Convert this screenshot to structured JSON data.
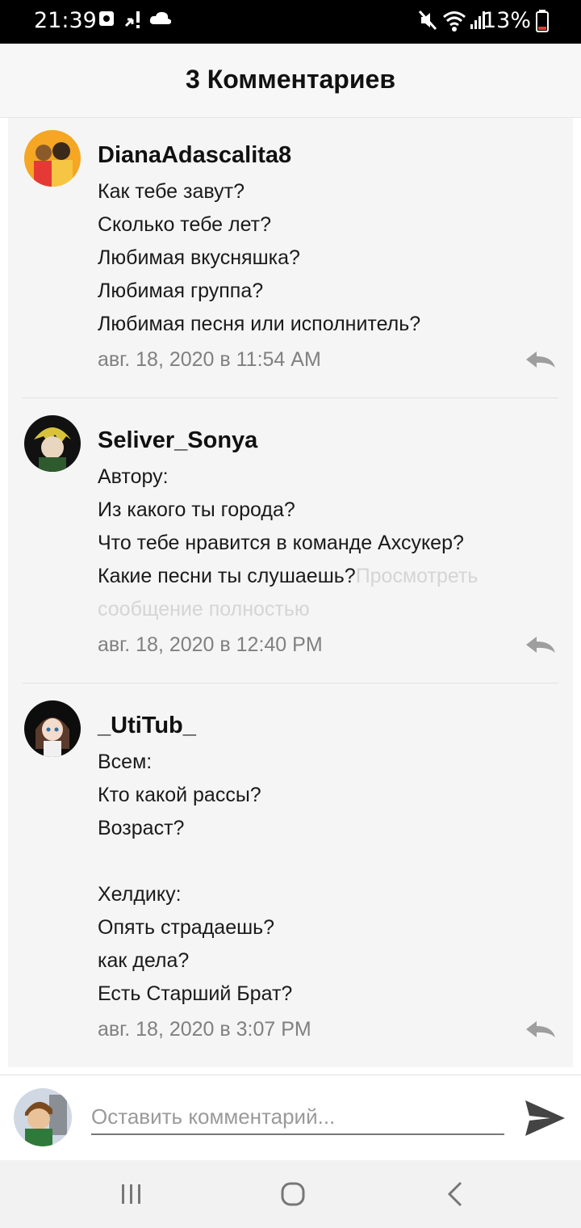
{
  "status_bar": {
    "time": "21:39",
    "battery": "13%",
    "left_icons": [
      "photo-notification-icon",
      "missed-call-icon",
      "cloud-icon"
    ],
    "right_icons": [
      "mute-icon",
      "wifi-icon",
      "signal-icon",
      "battery-icon"
    ]
  },
  "header": {
    "title": "3 Комментариев"
  },
  "comments": [
    {
      "username": "DianaAdascalita8",
      "lines": [
        "Как тебе завут?",
        "Сколько тебе лет?",
        "Любимая вкусняшка?",
        "Любимая группа?",
        "Любимая песня или исполнитель?"
      ],
      "timestamp": "авг. 18, 2020 в 11:54 AM"
    },
    {
      "username": "Seliver_Sonya",
      "lines": [
        "Автору:",
        "Из какого ты города?",
        "Что тебе нравится в команде Ахсукер?",
        "Какие песни ты слушаешь?"
      ],
      "more_inline": "Просмотреть",
      "more_line2": "сообщение полностью",
      "timestamp": "авг. 18, 2020 в 12:40 PM"
    },
    {
      "username": "_UtiTub_",
      "lines": [
        "Всем:",
        "Кто какой рассы?",
        "Возраст?",
        "",
        "Хелдику:",
        "Опять страдаешь?",
        "как дела?",
        "Есть Старший Брат?"
      ],
      "timestamp": "авг. 18, 2020 в 3:07 PM"
    }
  ],
  "composer": {
    "placeholder": "Оставить комментарий..."
  },
  "colors": {
    "send_icon": "#444444",
    "reply_icon": "#9e9e9e",
    "timestamp": "#808080",
    "panel": "#f5f5f5"
  },
  "nav_icons": [
    "recent-apps-icon",
    "home-icon",
    "back-icon"
  ]
}
